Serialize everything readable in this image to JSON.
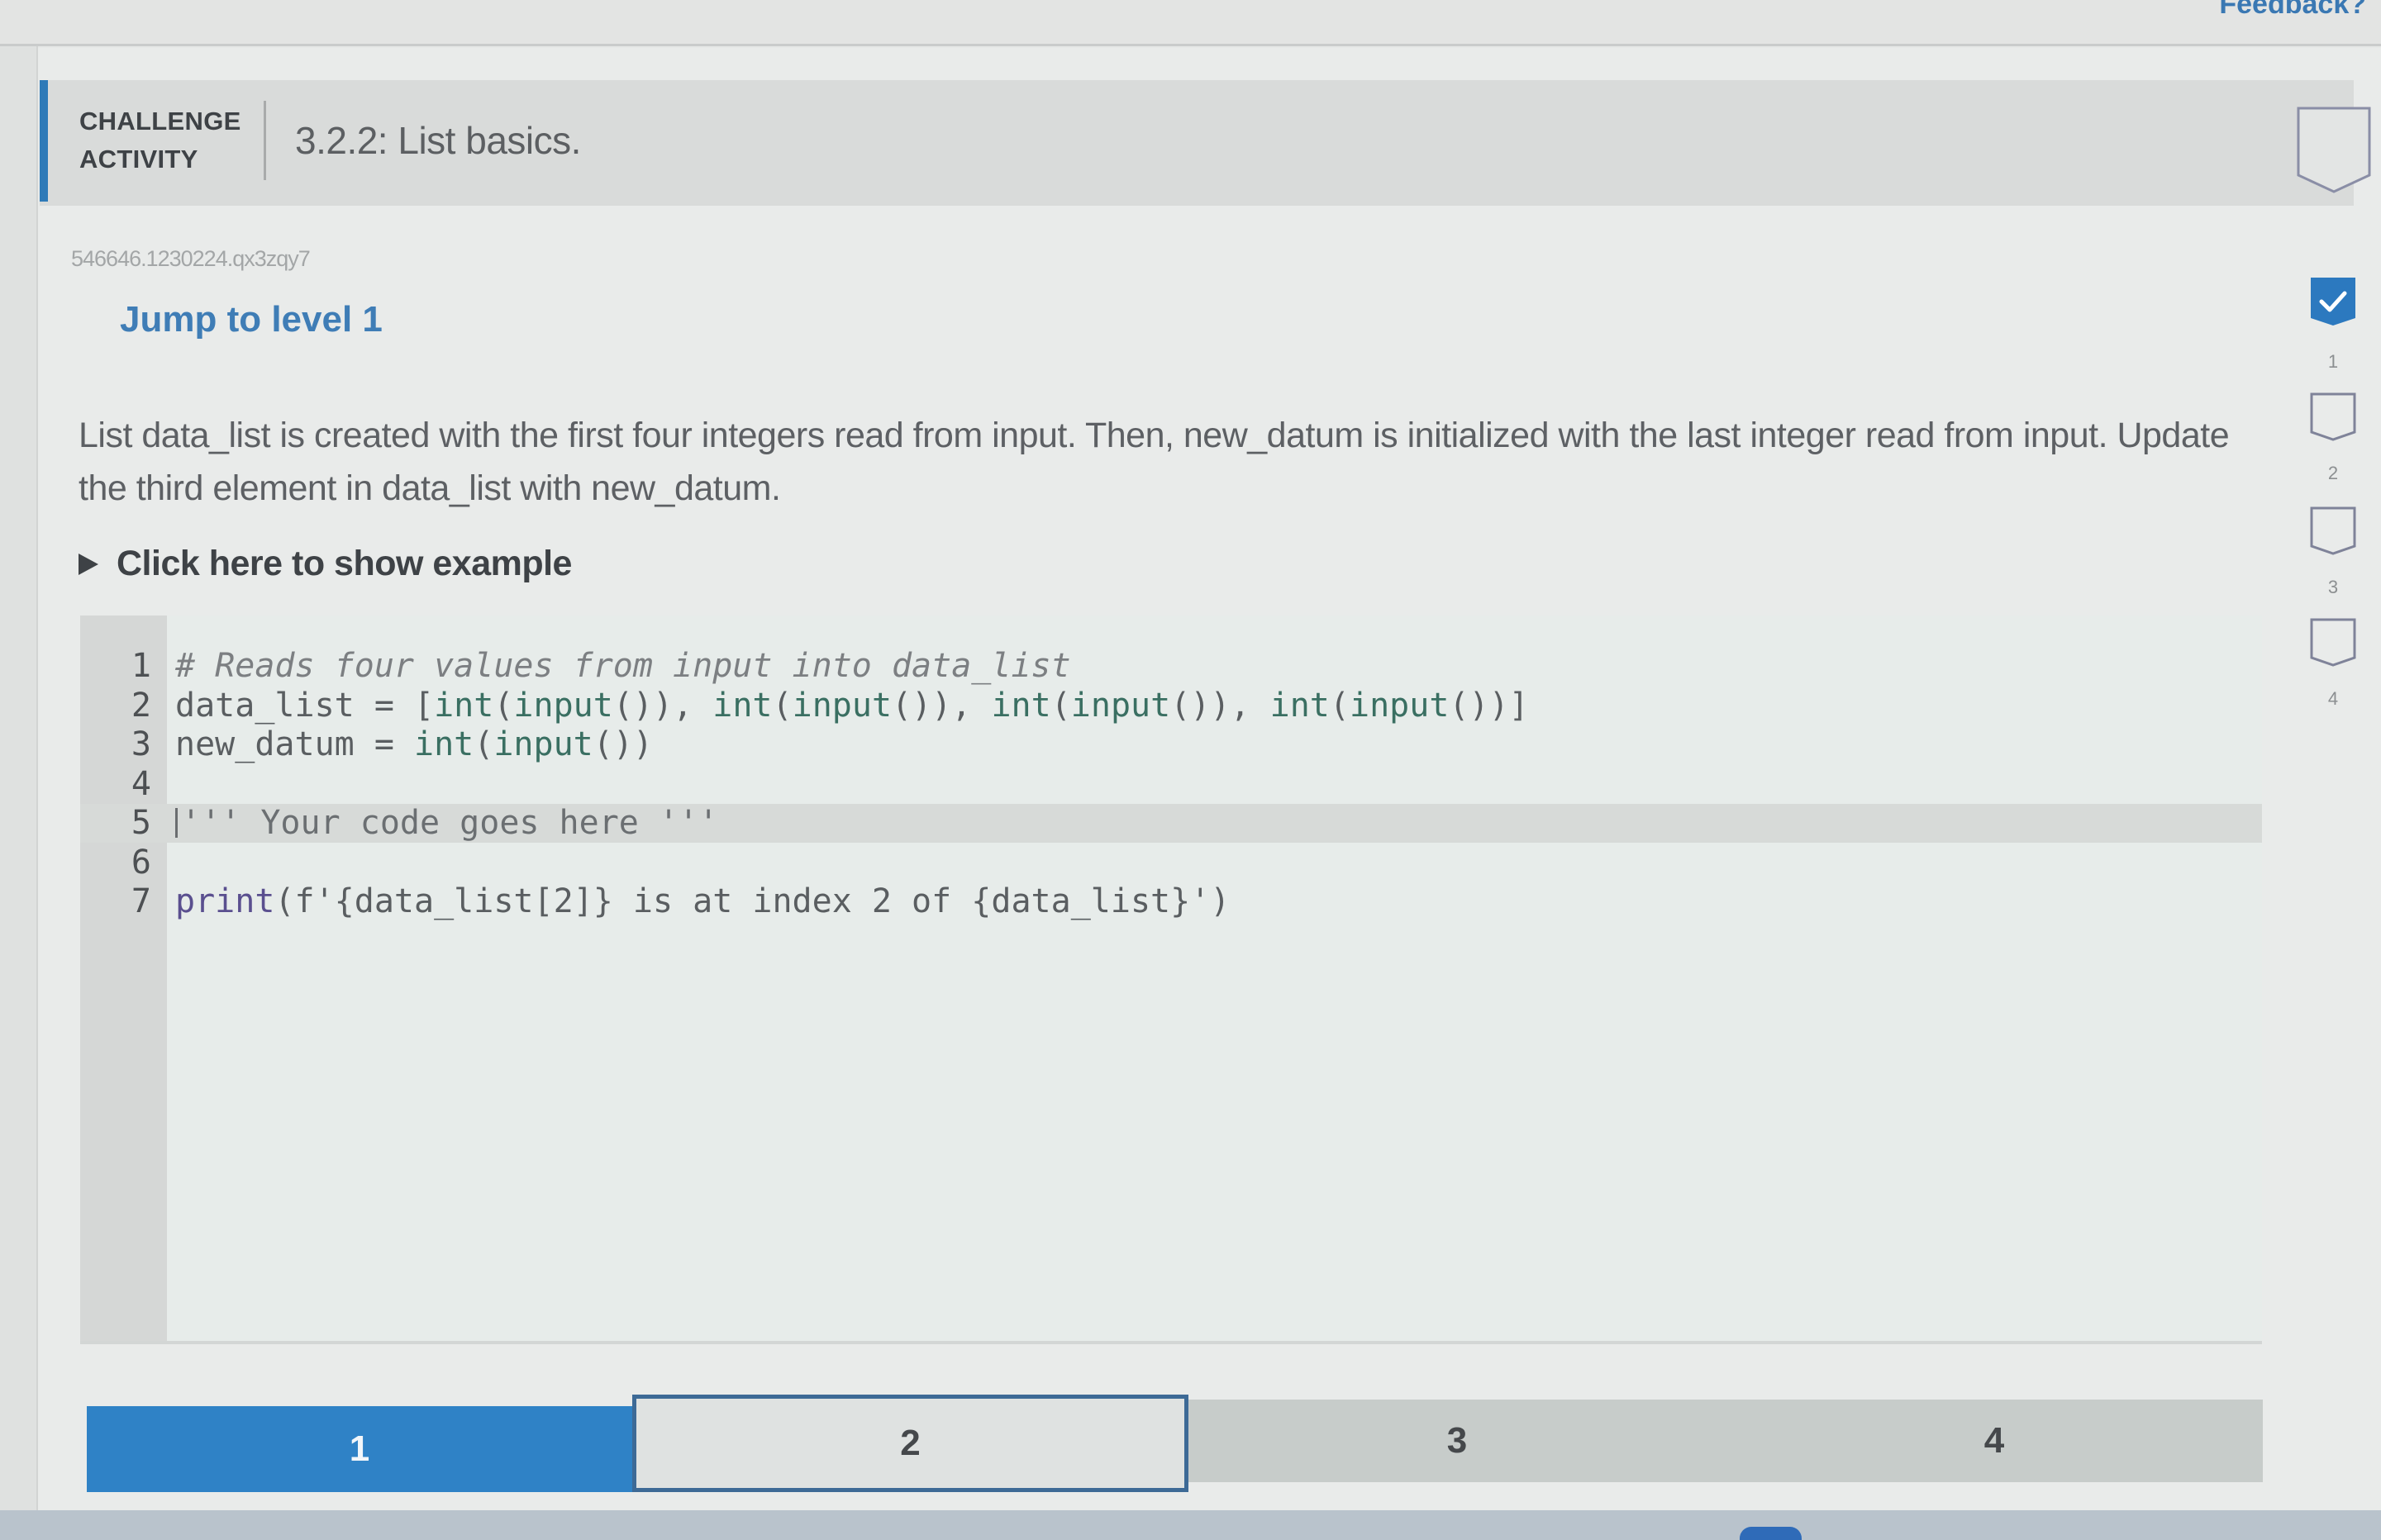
{
  "top_bar": {
    "feedback_label": "Feedback?"
  },
  "header": {
    "label_line1": "CHALLENGE",
    "label_line2": "ACTIVITY",
    "title": "3.2.2: List basics.",
    "accent_color": "#2e7ab8"
  },
  "activity": {
    "id": "546646.1230224.qx3zqy7",
    "jump_link": "Jump to level 1",
    "description": "List data_list is created with the first four integers read from input. Then, new_datum is initialized with the last integer read from input. Update the third element in data_list with new_datum.",
    "show_example": "Click here to show example"
  },
  "level_indicators": [
    {
      "label": "1",
      "completed": true
    },
    {
      "label": "2",
      "completed": false
    },
    {
      "label": "3",
      "completed": false
    },
    {
      "label": "4",
      "completed": false
    }
  ],
  "editor": {
    "active_line": 5,
    "lines": [
      {
        "number": "1",
        "text": "# Reads four values from input into data_list"
      },
      {
        "number": "2",
        "text": "data_list = [int(input()), int(input()), int(input()), int(input())]"
      },
      {
        "number": "3",
        "text": "new_datum = int(input())"
      },
      {
        "number": "4",
        "text": ""
      },
      {
        "number": "5",
        "text": "''' Your code goes here '''"
      },
      {
        "number": "6",
        "text": ""
      },
      {
        "number": "7",
        "text": "print(f'{data_list[2]} is at index 2 of {data_list}')"
      }
    ]
  },
  "level_bar": {
    "segments": [
      {
        "label": "1",
        "state": "completed"
      },
      {
        "label": "2",
        "state": "current"
      },
      {
        "label": "3",
        "state": "locked"
      },
      {
        "label": "4",
        "state": "locked"
      }
    ],
    "completed_color": "#2f82c6"
  }
}
